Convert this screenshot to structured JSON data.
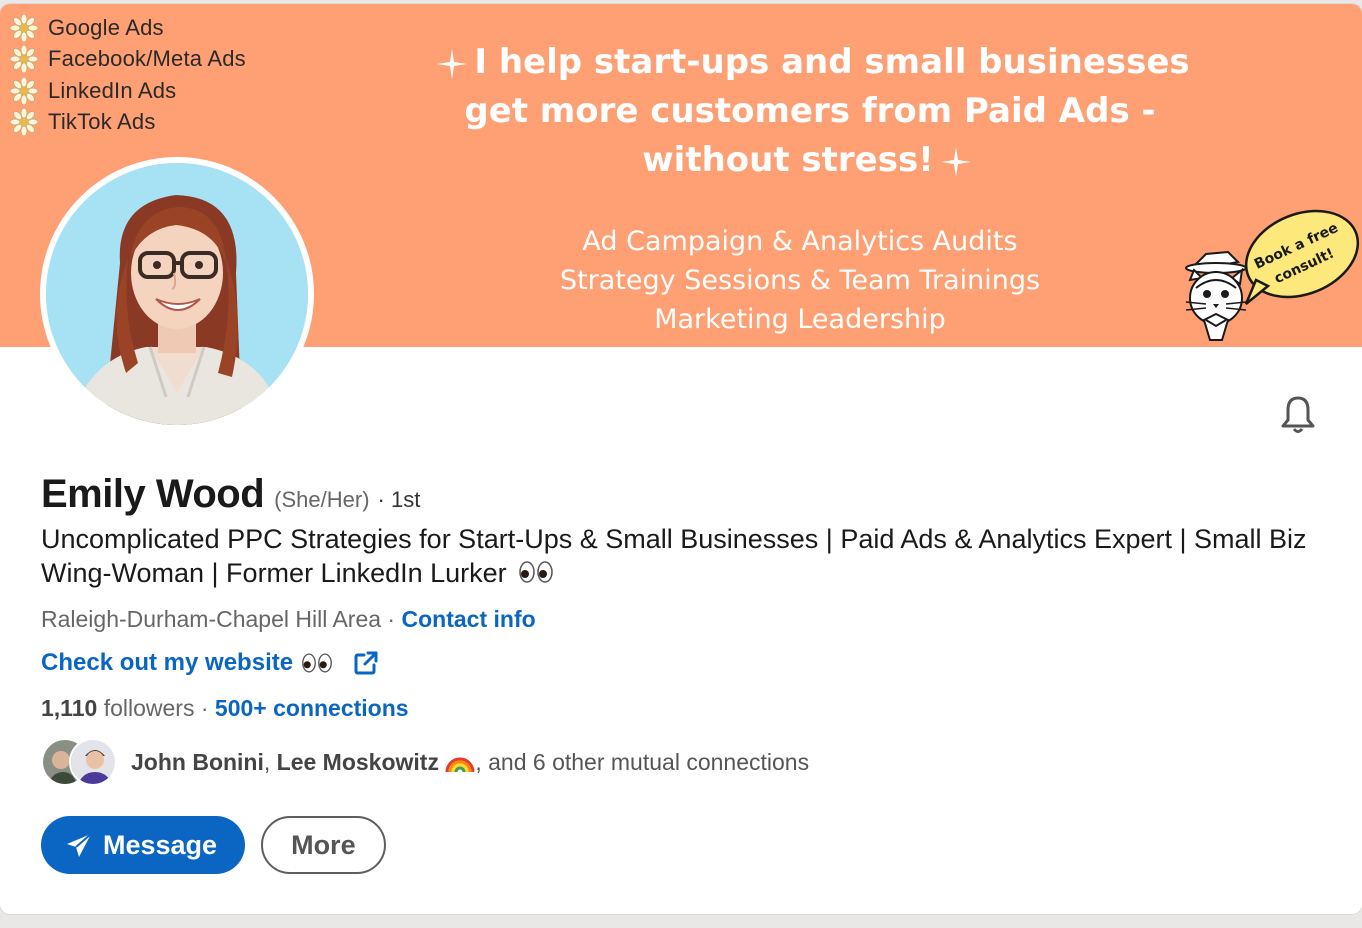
{
  "banner": {
    "platforms": [
      "Google Ads",
      "Facebook/Meta Ads",
      "LinkedIn Ads",
      "TikTok Ads"
    ],
    "headline_lines": [
      "I help start-ups and small businesses",
      "get more customers from Paid Ads -",
      "without stress!"
    ],
    "services": [
      "Ad Campaign & Analytics Audits",
      "Strategy Sessions & Team Trainings",
      "Marketing Leadership"
    ],
    "consult_bubble": [
      "Book a free",
      "consult!"
    ],
    "background_color": "#ff9f74"
  },
  "profile": {
    "name": "Emily Wood",
    "pronouns": "(She/Her)",
    "degree": "· 1st",
    "headline": "Uncomplicated PPC Strategies for Start-Ups & Small Businesses | Paid Ads & Analytics Expert | Small Biz Wing-Woman | Former LinkedIn Lurker",
    "location": "Raleigh-Durham-Chapel Hill Area",
    "location_separator": " · ",
    "contact_info_label": "Contact info",
    "website_label": "Check out my website",
    "followers_count": "1,110",
    "followers_label": "followers",
    "connections_separator": " · ",
    "connections_label": "500+ connections"
  },
  "mutual": {
    "first": "John Bonini",
    "second": "Lee Moskowitz",
    "rest": ", and 6 other mutual connections"
  },
  "actions": {
    "message_label": "Message",
    "more_label": "More"
  },
  "icons": {
    "bell": "bell-icon",
    "external_link": "external-link-icon",
    "send": "paper-plane-icon"
  },
  "colors": {
    "accent": "#0a66c2",
    "banner": "#ff9f74"
  }
}
